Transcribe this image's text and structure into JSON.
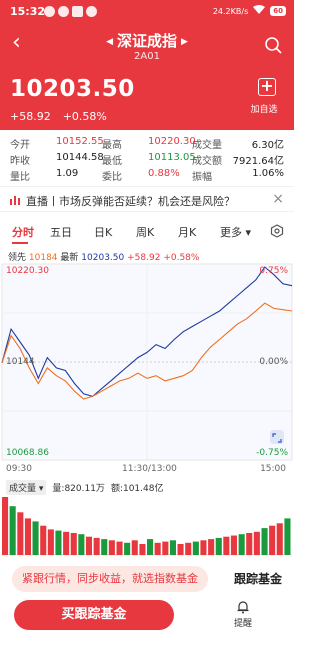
{
  "status": {
    "time": "15:32",
    "net_speed": "24.2",
    "net_unit": "KB/s",
    "battery": "60"
  },
  "header": {
    "title": "深证成指",
    "code": "2A01"
  },
  "quote": {
    "price": "10203.50",
    "change": "+58.92",
    "change_pct": "+0.58%"
  },
  "add_fav": {
    "label": "加自选"
  },
  "stats": {
    "open_label": "今开",
    "open": "10152.55",
    "high_label": "最高",
    "high": "10220.30",
    "vol_label": "成交量",
    "vol": "6.30亿",
    "prev_label": "昨收",
    "prev": "10144.58",
    "low_label": "最低",
    "low": "10113.05",
    "amt_label": "成交额",
    "amt": "7921.64亿",
    "ratio_label": "量比",
    "ratio": "1.09",
    "weibi_label": "委比",
    "weibi": "0.88%",
    "amp_label": "振幅",
    "amp": "1.06%"
  },
  "news": {
    "text": "直播丨市场反弹能否延续？机会还是风险？",
    "close": "×"
  },
  "tabs": {
    "t1": "分时",
    "t2": "五日",
    "t3": "日K",
    "t4": "周K",
    "t5": "月K",
    "more": "更多"
  },
  "legend": {
    "lead_label": "领先",
    "lead": "10184",
    "latest_label": "最新",
    "latest": "10203.50",
    "change": "+58.92",
    "pct": "+0.58%"
  },
  "chart_labels": {
    "top_price": "10220.30",
    "top_pct": "0.75%",
    "bottom_price": "10068.86",
    "bottom_pct": "-0.75%",
    "mid_pct": "0.00%",
    "mid_price": "10144"
  },
  "time_axis": {
    "start": "09:30",
    "mid": "11:30/13:00",
    "end": "15:00"
  },
  "volume": {
    "tag": "成交量",
    "vol": "量:820.11万",
    "amt": "额:101.48亿"
  },
  "bottom": {
    "promo": "紧跟行情，同步收益，就选指数基金",
    "follow": "跟踪基金",
    "buy": "买跟踪基金",
    "alert": "提醒"
  },
  "colors": {
    "brand": "#e8383f",
    "up": "#e8383f",
    "down": "#1a9a3c",
    "index_line": "#1e3aa0",
    "lead_line": "#f07020"
  },
  "chart_data": {
    "type": "line",
    "title": "",
    "x": [
      "09:30",
      "11:30/13:00",
      "15:00"
    ],
    "ylim": [
      10068.86,
      10220.3
    ],
    "prev_close": 10144.58,
    "series": [
      {
        "name": "最新",
        "color": "#1e3aa0",
        "values": [
          10144,
          10170,
          10160,
          10150,
          10132,
          10148,
          10140,
          10138,
          10128,
          10120,
          10118,
          10124,
          10130,
          10136,
          10142,
          10148,
          10152,
          10158,
          10155,
          10162,
          10168,
          10172,
          10176,
          10180,
          10184,
          10190,
          10196,
          10202,
          10208,
          10218,
          10212,
          10205,
          10203.5
        ]
      },
      {
        "name": "领先",
        "color": "#f07020",
        "values": [
          10144,
          10165,
          10155,
          10140,
          10128,
          10140,
          10134,
          10130,
          10122,
          10116,
          10118,
          10122,
          10126,
          10130,
          10132,
          10136,
          10132,
          10134,
          10130,
          10132,
          10134,
          10138,
          10148,
          10156,
          10162,
          10168,
          10174,
          10178,
          10184,
          10190,
          10186,
          10185,
          10184
        ]
      }
    ],
    "volume": [
      95,
      80,
      70,
      60,
      55,
      48,
      42,
      40,
      38,
      36,
      34,
      30,
      28,
      26,
      24,
      22,
      20,
      24,
      18,
      26,
      20,
      22,
      24,
      18,
      20,
      22,
      24,
      26,
      28,
      30,
      32,
      34,
      36,
      38,
      44,
      48,
      52,
      60
    ]
  }
}
